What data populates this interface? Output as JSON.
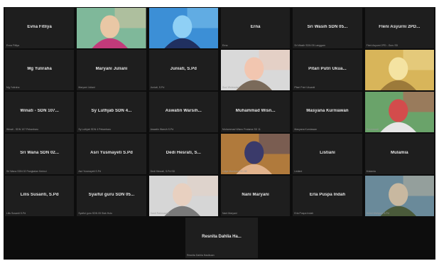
{
  "participants": [
    {
      "name": "Evna Fitliya",
      "sub": "Evna Fitliya"
    },
    {
      "name": "",
      "sub": ""
    },
    {
      "name": "",
      "sub": ""
    },
    {
      "name": "Erna",
      "sub": "Erna"
    },
    {
      "name": "Sri Wasih SDN 05...",
      "sub": "Sri Wasih SDN 05 Langgam"
    },
    {
      "name": "Fleni Asyurni 2PD...",
      "sub": "Fleni Asyurni 2PD - Guru SD"
    },
    {
      "name": "Mg Yuliraha",
      "sub": "Mg Yuliraha"
    },
    {
      "name": "Maryani Juliani",
      "sub": "Maryani Juliani"
    },
    {
      "name": "Juniati, S.Pd",
      "sub": "Juniati, S.Pd"
    },
    {
      "name": "",
      "sub": "Suci Wulandari"
    },
    {
      "name": "Pitari Putri Ukua...",
      "sub": "Pitari Putri Ukuanti"
    },
    {
      "name": "",
      "sub": ""
    },
    {
      "name": "Winati - SDN 107...",
      "sub": "Winati - SDN 107 Pekanbaru"
    },
    {
      "name": "Sy Luthjab SDN 4...",
      "sub": "Sy Luthjab SDN 4 Pekanbaru"
    },
    {
      "name": "Aswatin Warsih...",
      "sub": "Aswatin Warsih S.Pd"
    },
    {
      "name": "Muhammad Wisn...",
      "sub": "Muhammad Wisnu Pratama SD 11"
    },
    {
      "name": "Masyana Kurniawan",
      "sub": "Masyana Kurniawan"
    },
    {
      "name": "",
      "sub": "Rosmawati"
    },
    {
      "name": "Sri Wana SDN 02...",
      "sub": "Sri Wana SDN 02 Pangkalan Kerinci"
    },
    {
      "name": "Asri Yusmayeti S.Pd",
      "sub": "Asri Yusmayeti S.Pd"
    },
    {
      "name": "Dedi Hesrati, S...",
      "sub": "Dedi Hesrati, S.Pd SD"
    },
    {
      "name": "",
      "sub": "Lidya Mardiana SD 88"
    },
    {
      "name": "Listiani",
      "sub": "Listiani"
    },
    {
      "name": "Mulamia",
      "sub": "Mulamia"
    },
    {
      "name": "Lilis Susanti, S.Pd",
      "sub": "Lilis Susanti S.Pd"
    },
    {
      "name": "Syaiful guru SDN 05...",
      "sub": "Syaiful guru SDN 05 Siak Hulu"
    },
    {
      "name": "",
      "sub": "Santi Rahmawati"
    },
    {
      "name": "Nani Maryani",
      "sub": "Nani Maryani"
    },
    {
      "name": "Erla Puspa Indah",
      "sub": "Erla Puspa Indah"
    },
    {
      "name": "",
      "sub": "Helmi Wahyuni S.Pd"
    }
  ],
  "last_participant": {
    "name": "Resnita Dahlia Ha...",
    "sub": "Resnita Dahlia Hasibuan"
  },
  "video_tiles": [
    1,
    2,
    9,
    11,
    17,
    21,
    26,
    29
  ]
}
